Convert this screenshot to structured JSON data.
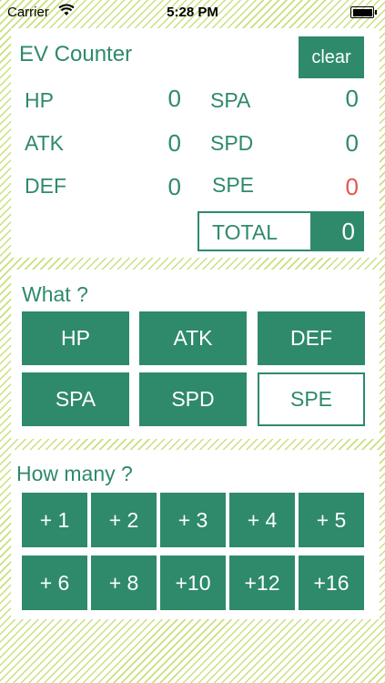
{
  "status_bar": {
    "carrier": "Carrier",
    "time": "5:28 PM"
  },
  "counter": {
    "title": "EV Counter",
    "clear_label": "clear",
    "stats": [
      {
        "label": "HP",
        "value": "0"
      },
      {
        "label": "ATK",
        "value": "0"
      },
      {
        "label": "DEF",
        "value": "0"
      },
      {
        "label": "SPA",
        "value": "0"
      },
      {
        "label": "SPD",
        "value": "0"
      },
      {
        "label": "SPE",
        "value": "0"
      }
    ],
    "highlight_color": "#e05a4a",
    "total_label": "TOTAL",
    "total_value": "0"
  },
  "what": {
    "title": "What ?",
    "options": [
      "HP",
      "ATK",
      "DEF",
      "SPA",
      "SPD",
      "SPE"
    ],
    "selected": "SPE"
  },
  "how_many": {
    "title": "How many ?",
    "options": [
      "+ 1",
      "+ 2",
      "+ 3",
      "+ 4",
      "+ 5",
      "+ 6",
      "+ 8",
      "+10",
      "+12",
      "+16"
    ]
  },
  "colors": {
    "accent": "#2e8a6a",
    "stripe": "#c9e07f"
  }
}
